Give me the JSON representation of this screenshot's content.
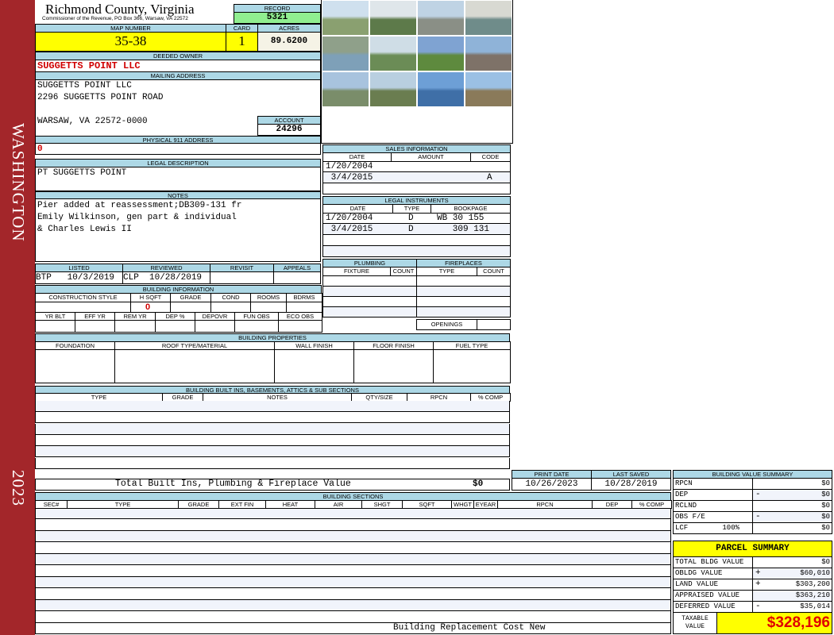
{
  "sidebar": {
    "district": "WASHINGTON",
    "year": "2023"
  },
  "header": {
    "title": "Richmond County, Virginia",
    "subtitle": "Commissioner of the Revenue, PO Box 366, Warsaw, VA 22572",
    "record_label": "RECORD",
    "record": "5321"
  },
  "parcel": {
    "map_label": "MAP NUMBER",
    "map": "35-38",
    "card_label": "CARD",
    "card": "1",
    "acres_label": "ACRES",
    "acres": "89.6200"
  },
  "owner": {
    "label": "DEEDED OWNER",
    "value": "SUGGETTS POINT LLC"
  },
  "mailing": {
    "label": "MAILING ADDRESS",
    "line1": "SUGGETTS POINT LLC",
    "line2": "2296 SUGGETTS POINT ROAD",
    "line3": "WARSAW, VA 22572-0000",
    "account_label": "ACCOUNT",
    "account": "24296"
  },
  "physical": {
    "label": "PHYSICAL 911 ADDRESS",
    "value": "0"
  },
  "legal": {
    "label": "LEGAL DESCRIPTION",
    "value": "PT SUGGETTS POINT"
  },
  "notes": {
    "label": "NOTES",
    "line1": "Pier added at reassessment;DB309-131 fr",
    "line2": "Emily Wilkinson, gen part & individual",
    "line3": "& Charles Lewis II"
  },
  "listed": {
    "listed_label": "LISTED",
    "listed": "BTP   10/3/2019",
    "reviewed_label": "REVIEWED",
    "reviewed": "CLP  10/28/2019",
    "revisit_label": "REVISIT",
    "appeals_label": "APPEALS"
  },
  "building_info": {
    "label": "BUILDING INFORMATION",
    "cols1": [
      "CONSTRUCTION STYLE",
      "H SQFT",
      "GRADE",
      "COND",
      "ROOMS",
      "BDRMS"
    ],
    "hsqft": "0",
    "cols2": [
      "YR BLT",
      "EFF YR",
      "REM YR",
      "DEP %",
      "DEPOVR",
      "FUN OBS",
      "ECO OBS"
    ]
  },
  "sales": {
    "label": "SALES INFORMATION",
    "cols": [
      "DATE",
      "AMOUNT",
      "CODE"
    ],
    "rows": [
      {
        "date": "1/20/2004",
        "amount": "",
        "code": ""
      },
      {
        "date": " 3/4/2015",
        "amount": "",
        "code": "A"
      }
    ]
  },
  "instruments": {
    "label": "LEGAL INSTRUMENTS",
    "cols": [
      "DATE",
      "TYPE",
      "BOOKPAGE"
    ],
    "rows": [
      {
        "date": "1/20/2004",
        "type": "D",
        "bookpage": "WB 30 155"
      },
      {
        "date": " 3/4/2015",
        "type": "D",
        "bookpage": "   309 131"
      }
    ]
  },
  "plumbing": {
    "label": "PLUMBING",
    "cols": [
      "FIXTURE",
      "COUNT"
    ]
  },
  "fireplaces": {
    "label": "FIREPLACES",
    "cols": [
      "TYPE",
      "COUNT"
    ],
    "openings": "OPENINGS"
  },
  "properties": {
    "label": "BUILDING PROPERTIES",
    "cols": [
      "FOUNDATION",
      "ROOF TYPE/MATERIAL",
      "WALL FINISH",
      "FLOOR FINISH",
      "FUEL TYPE"
    ]
  },
  "builtins": {
    "label": "BUILDING BUILT INS, BASEMENTS, ATTICS & SUB SECTIONS",
    "cols": [
      "TYPE",
      "GRADE",
      "NOTES",
      "QTY/SIZE",
      "RPCN",
      "% COMP"
    ],
    "total_label": "Total Built Ins, Plumbing & Fireplace Value",
    "total": "$0"
  },
  "dates": {
    "print_label": "PRINT DATE",
    "print": "10/26/2023",
    "saved_label": "LAST SAVED",
    "saved": "10/28/2019"
  },
  "sections": {
    "label": "BUILDING SECTIONS",
    "cols": [
      "SEC#",
      "TYPE",
      "GRADE",
      "EXT FIN",
      "HEAT",
      "AIR",
      "SHGT",
      "SQFT",
      "WHGT",
      "EYEAR",
      "RPCN",
      "DEP",
      "% COMP"
    ],
    "footer": "Building Replacement Cost New"
  },
  "bvs": {
    "label": "BUILDING VALUE SUMMARY",
    "rows": [
      {
        "label": "RPCN",
        "sign": "",
        "value": "$0"
      },
      {
        "label": "DEP",
        "sign": "-",
        "value": "$0"
      },
      {
        "label": "RCLND",
        "sign": "",
        "value": "$0"
      },
      {
        "label": "OBS F/E",
        "sign": "-",
        "value": "$0"
      },
      {
        "label": "LCF        100%",
        "sign": "",
        "value": "$0"
      }
    ]
  },
  "parcel_summary": {
    "label": "PARCEL SUMMARY",
    "rows": [
      {
        "label": "TOTAL BLDG VALUE",
        "sign": "",
        "value": "$0"
      },
      {
        "label": "OBLDG VALUE",
        "sign": "+",
        "value": "$60,010"
      },
      {
        "label": "LAND VALUE",
        "sign": "+",
        "value": "$303,200"
      },
      {
        "label": "APPRAISED VALUE",
        "sign": "",
        "value": "$363,210"
      },
      {
        "label": "DEFERRED VALUE",
        "sign": "-",
        "value": "$35,014"
      }
    ],
    "taxable_label": "TAXABLE VALUE",
    "taxable": "$328,196"
  },
  "colors": {
    "sidebar": "#a3262a",
    "header": "#add8e6",
    "highlight": "#ffff00",
    "record": "#90ee90",
    "alert": "#d00000"
  }
}
